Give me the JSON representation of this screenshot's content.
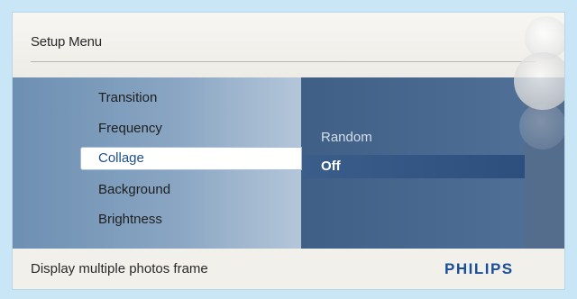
{
  "header": {
    "title": "Setup Menu"
  },
  "menu": {
    "items": [
      {
        "label": "Transition"
      },
      {
        "label": "Frequency"
      },
      {
        "label": "Collage",
        "selected": true
      },
      {
        "label": "Background"
      },
      {
        "label": "Brightness"
      }
    ]
  },
  "submenu": {
    "items": [
      {
        "label": "Random"
      },
      {
        "label": "Off",
        "selected": true
      }
    ]
  },
  "footer": {
    "description": "Display multiple photos frame",
    "brand": "PHILIPS"
  },
  "colors": {
    "background": "#c9e6f6",
    "selected_text": "#1d4f8e",
    "brand": "#1a4e9b",
    "submenu_bg": "#4a6a92"
  }
}
